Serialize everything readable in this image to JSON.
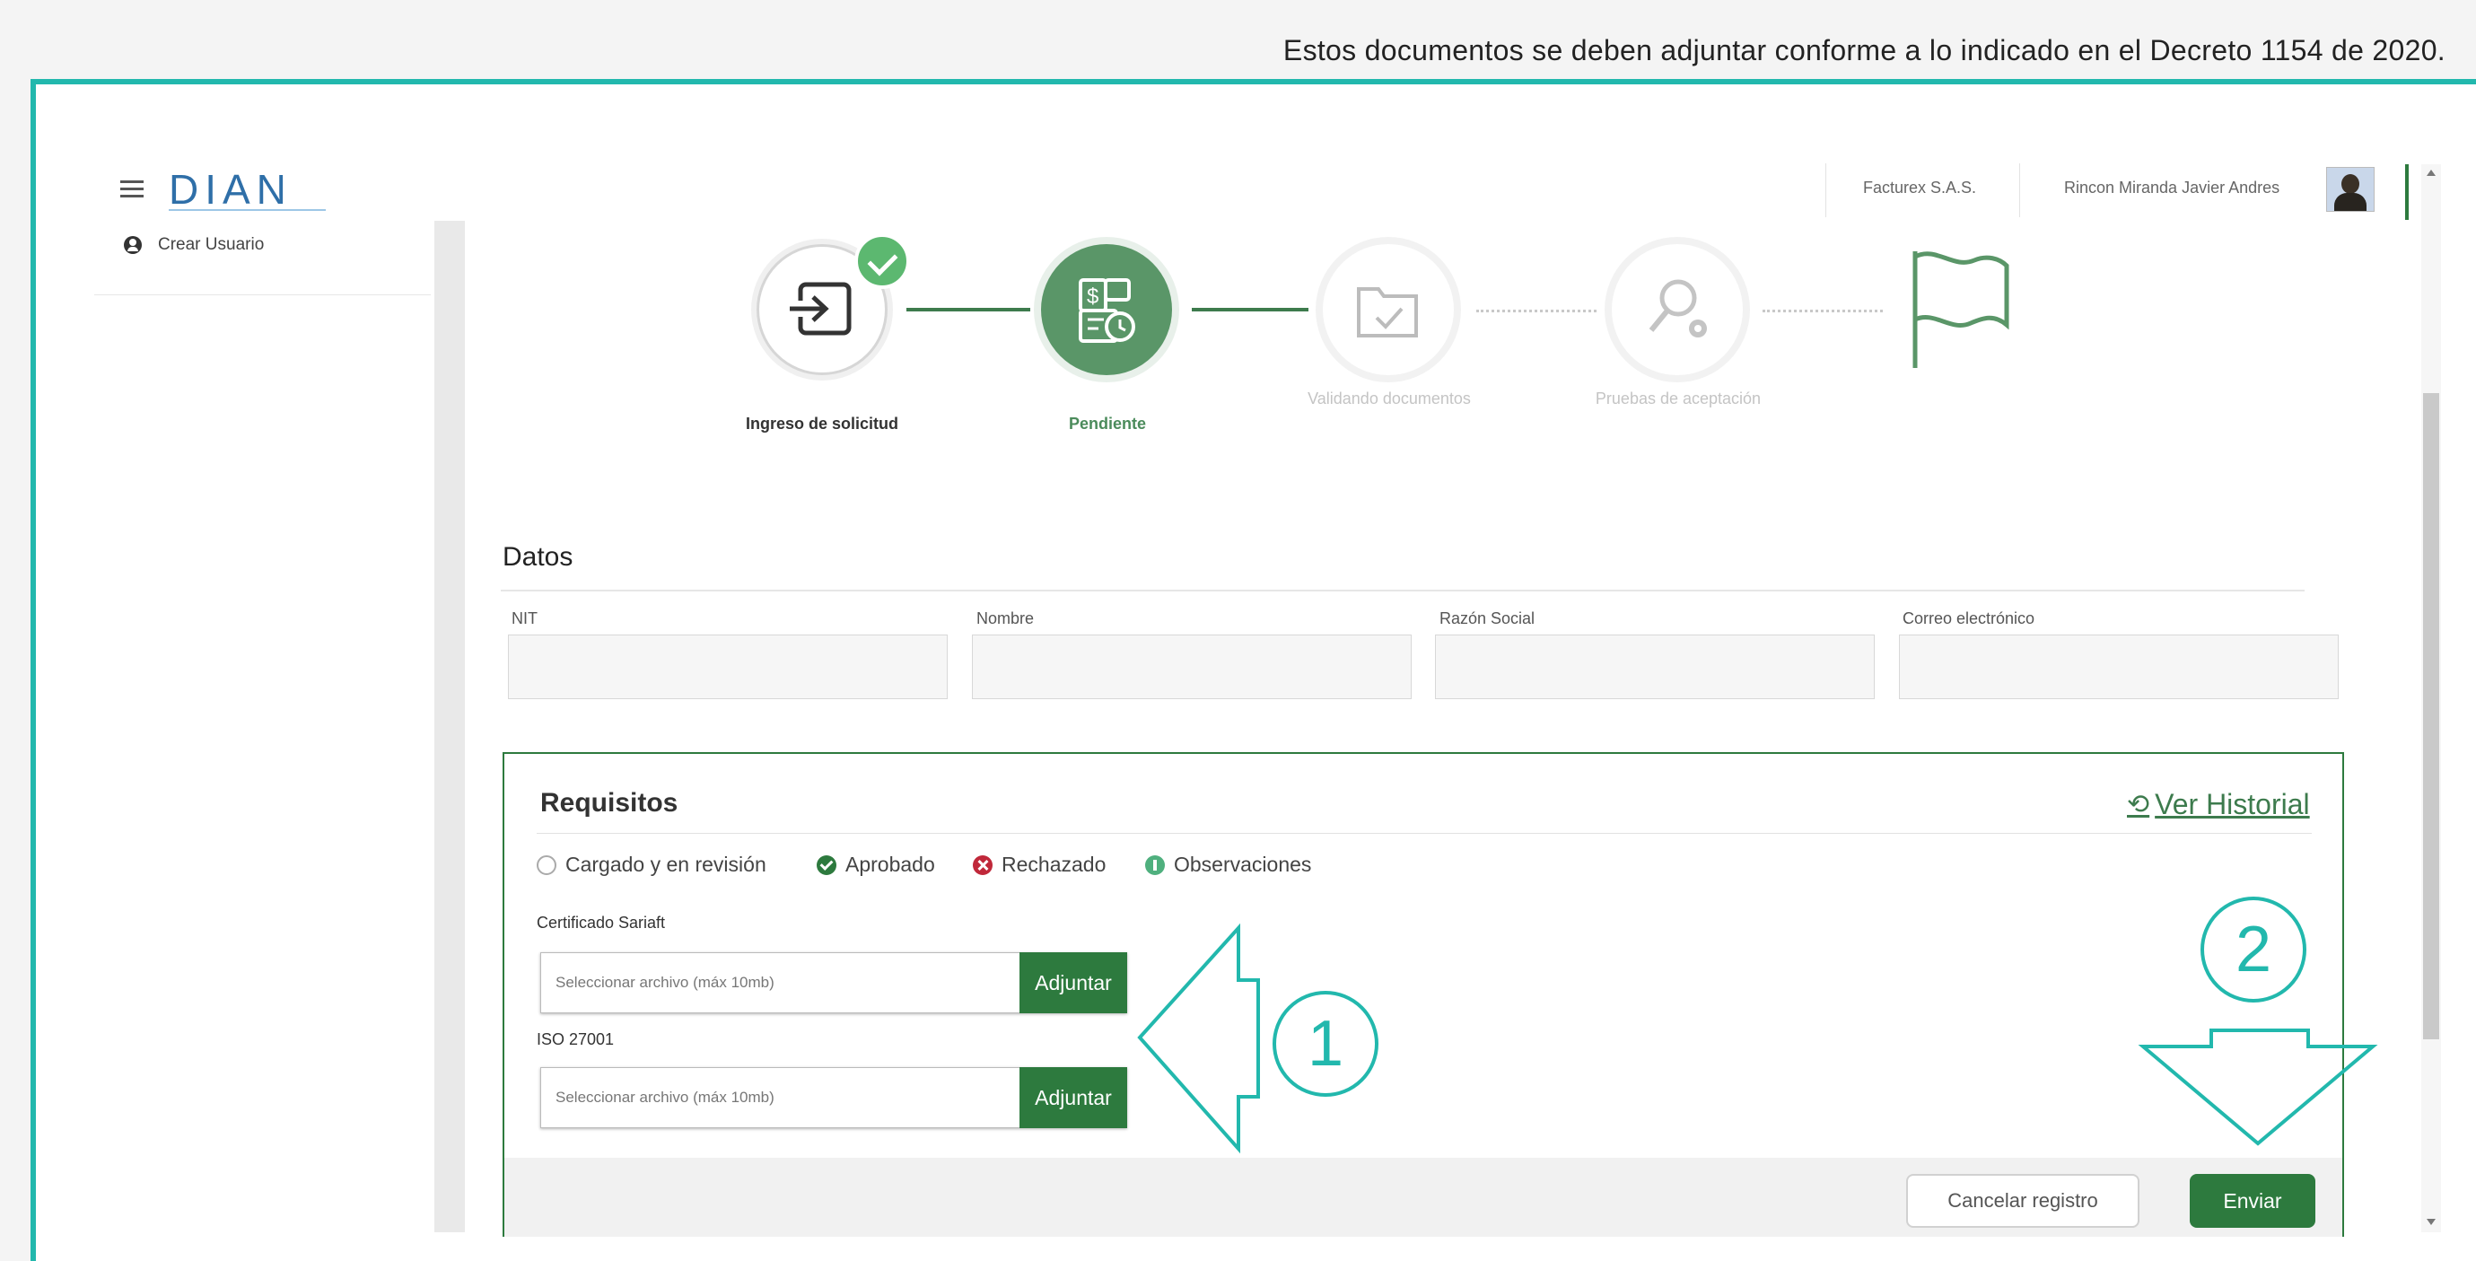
{
  "top_note": "Estos documentos se deben adjuntar conforme a lo indicado en el Decreto 1154 de 2020.",
  "header": {
    "logo_text": "DIAN",
    "company": "Facturex S.A.S.",
    "user_name": "Rincon Miranda Javier Andres"
  },
  "sidebar": {
    "items": [
      {
        "label": "Crear Usuario",
        "icon": "user-circle-icon"
      }
    ]
  },
  "stepper": {
    "steps": [
      {
        "label": "Ingreso de solicitud",
        "state": "completed",
        "icon": "login-arrow-icon"
      },
      {
        "label": "Pendiente",
        "state": "current",
        "icon": "payment-document-icon"
      },
      {
        "label": "Validando documentos",
        "state": "future",
        "icon": "folder-check-icon"
      },
      {
        "label": "Pruebas de aceptación",
        "state": "future",
        "icon": "search-gear-icon"
      },
      {
        "label": "",
        "state": "future",
        "icon": "flag-icon"
      }
    ]
  },
  "datos": {
    "title": "Datos",
    "fields": [
      {
        "label": "NIT",
        "value": ""
      },
      {
        "label": "Nombre",
        "value": ""
      },
      {
        "label": "Razón Social",
        "value": ""
      },
      {
        "label": "Correo electrónico",
        "value": ""
      }
    ]
  },
  "requisitos": {
    "title": "Requisitos",
    "historial_link": "Ver Historial",
    "legend": [
      {
        "label": "Cargado y en revisión",
        "type": "upload"
      },
      {
        "label": "Aprobado",
        "type": "ok"
      },
      {
        "label": "Rechazado",
        "type": "no"
      },
      {
        "label": "Observaciones",
        "type": "obs"
      }
    ],
    "files": [
      {
        "label": "Certificado Sariaft",
        "placeholder": "Seleccionar archivo (máx 10mb)",
        "button": "Adjuntar"
      },
      {
        "label": "ISO 27001",
        "placeholder": "Seleccionar archivo (máx 10mb)",
        "button": "Adjuntar"
      }
    ]
  },
  "footer": {
    "cancel": "Cancelar registro",
    "send": "Enviar"
  },
  "annotations": {
    "one": "1",
    "two": "2",
    "color": "#22b8ad"
  },
  "colors": {
    "brand_green": "#2d7a3e",
    "accent_teal": "#22b8ad",
    "reject_red": "#c0283a"
  }
}
